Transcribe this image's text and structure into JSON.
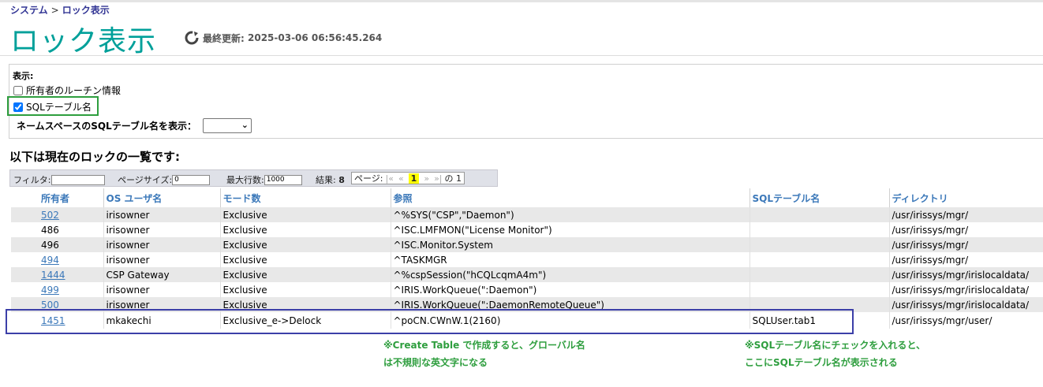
{
  "breadcrumb": {
    "root": "システム",
    "separator": ">",
    "current": "ロック表示"
  },
  "page_title": "ロック表示",
  "last_update": {
    "label": "最終更新:",
    "value": "2025-03-06 06:56:45.264"
  },
  "options": {
    "label": "表示:",
    "owner_routine": {
      "label": "所有者のルーチン情報",
      "checked": false
    },
    "sql_table": {
      "label": "SQLテーブル名",
      "checked": true
    },
    "namespace_label": "ネームスペースのSQLテーブル名を表示：",
    "namespace_value": ""
  },
  "section_title": "以下は現在のロックの一覧です:",
  "filterbar": {
    "filter_label": "フィルタ:",
    "filter_value": "",
    "page_size_label": "ページサイズ:",
    "page_size_value": "0",
    "max_rows_label": "最大行数:",
    "max_rows_value": "1000",
    "results_label": "結果:",
    "results_value": "8",
    "pager_label": "ページ:",
    "pager_first": "|«",
    "pager_prev": "«",
    "pager_current": "1",
    "pager_next": "»",
    "pager_last": "»|",
    "pager_of": "の 1"
  },
  "table": {
    "headers": [
      "所有者",
      "OS ユーザ名",
      "モード数",
      "参照",
      "SQLテーブル名",
      "ディレクトリ"
    ],
    "rows": [
      {
        "owner": "502",
        "link": true,
        "user": "irisowner",
        "mode": "Exclusive",
        "ref": "^%SYS(\"CSP\",\"Daemon\")",
        "sql": "",
        "dir": "/usr/irissys/mgr/"
      },
      {
        "owner": "486",
        "link": false,
        "user": "irisowner",
        "mode": "Exclusive",
        "ref": "^ISC.LMFMON(\"License Monitor\")",
        "sql": "",
        "dir": "/usr/irissys/mgr/"
      },
      {
        "owner": "496",
        "link": false,
        "user": "irisowner",
        "mode": "Exclusive",
        "ref": "^ISC.Monitor.System",
        "sql": "",
        "dir": "/usr/irissys/mgr/"
      },
      {
        "owner": "494",
        "link": true,
        "user": "irisowner",
        "mode": "Exclusive",
        "ref": "^TASKMGR",
        "sql": "",
        "dir": "/usr/irissys/mgr/"
      },
      {
        "owner": "1444",
        "link": true,
        "user": "CSP Gateway",
        "mode": "Exclusive",
        "ref": "^%cspSession(\"hCQLcqmA4m\")",
        "sql": "",
        "dir": "/usr/irissys/mgr/irislocaldata/"
      },
      {
        "owner": "499",
        "link": true,
        "user": "irisowner",
        "mode": "Exclusive",
        "ref": "^IRIS.WorkQueue(\":Daemon\")",
        "sql": "",
        "dir": "/usr/irissys/mgr/irislocaldata/"
      },
      {
        "owner": "500",
        "link": true,
        "user": "irisowner",
        "mode": "Exclusive",
        "ref": "^IRIS.WorkQueue(\":DaemonRemoteQueue\")",
        "sql": "",
        "dir": "/usr/irissys/mgr/irislocaldata/"
      },
      {
        "owner": "1451",
        "link": true,
        "user": "mkakechi",
        "mode": "Exclusive_e->Delock",
        "ref": "^poCN.CWnW.1(2160)",
        "sql": "SQLUser.tab1",
        "dir": "/usr/irissys/mgr/user/"
      }
    ]
  },
  "notes": {
    "left_line1": "※Create Table で作成すると、グローバル名",
    "left_line2": "は不規則な英文字になる",
    "right_line1": "※SQLテーブル名にチェックを入れると、",
    "right_line2": "ここにSQLテーブル名が表示される"
  },
  "colors": {
    "title": "#00a09a",
    "link": "#3b78b9",
    "highlight_green": "#2e9e3e",
    "highlight_blue": "#3c3fa8"
  }
}
